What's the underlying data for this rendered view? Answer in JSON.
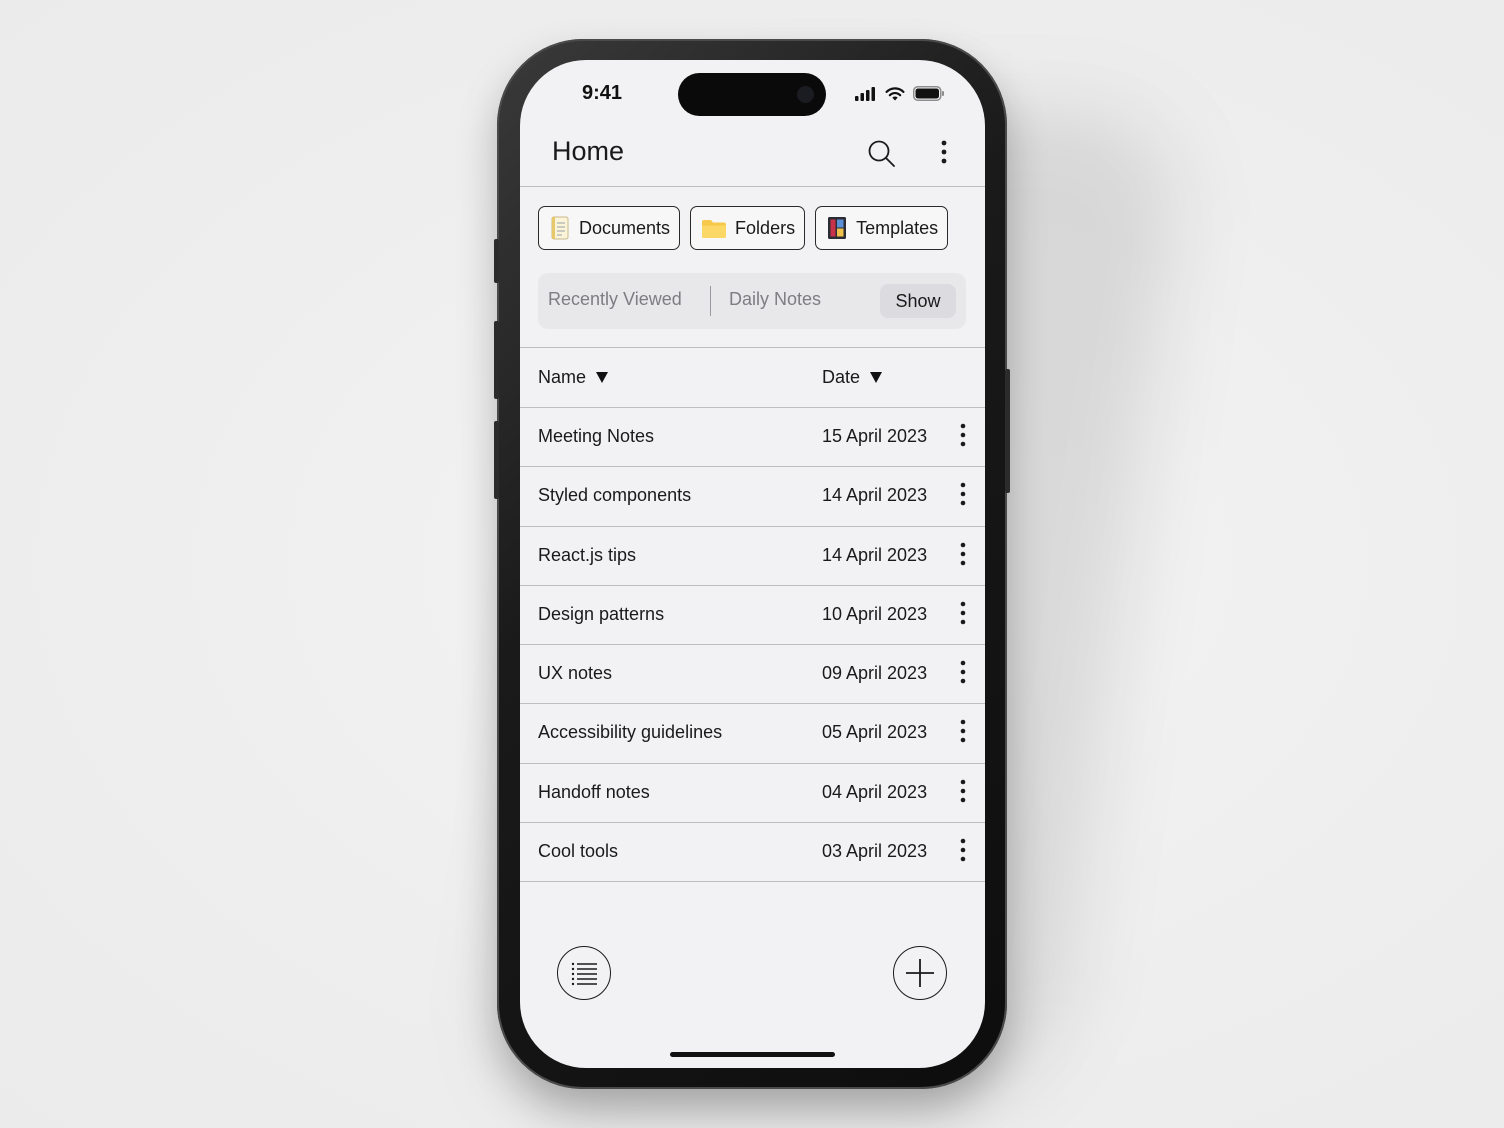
{
  "status_bar": {
    "time": "9:41"
  },
  "header": {
    "title": "Home",
    "search_icon": "search-icon",
    "more_icon": "more-vertical-icon"
  },
  "chips": [
    {
      "label": "Documents",
      "icon": "document-icon"
    },
    {
      "label": "Folders",
      "icon": "folder-icon"
    },
    {
      "label": "Templates",
      "icon": "templates-icon"
    }
  ],
  "segment": {
    "recently_viewed": "Recently Viewed",
    "daily_notes": "Daily Notes",
    "show": "Show"
  },
  "table": {
    "columns": {
      "name": "Name",
      "date": "Date"
    },
    "rows": [
      {
        "name": "Meeting Notes",
        "date": "15 April 2023"
      },
      {
        "name": "Styled components",
        "date": "14 April 2023"
      },
      {
        "name": "React.js tips",
        "date": "14 April 2023"
      },
      {
        "name": "Design patterns",
        "date": "10 April 2023"
      },
      {
        "name": "UX notes",
        "date": "09 April 2023"
      },
      {
        "name": "Accessibility guidelines",
        "date": "05 April 2023"
      },
      {
        "name": "Handoff notes",
        "date": "04 April 2023"
      },
      {
        "name": "Cool tools",
        "date": "03 April 2023"
      }
    ]
  },
  "bottom_bar": {
    "list_icon": "list-icon",
    "add_icon": "plus-icon"
  },
  "colors": {
    "screen_bg": "#f2f2f4",
    "text": "#1a1a1a",
    "muted_text": "#7d7d82",
    "divider": "#bfbfc2",
    "folder": "#f6c94a"
  }
}
